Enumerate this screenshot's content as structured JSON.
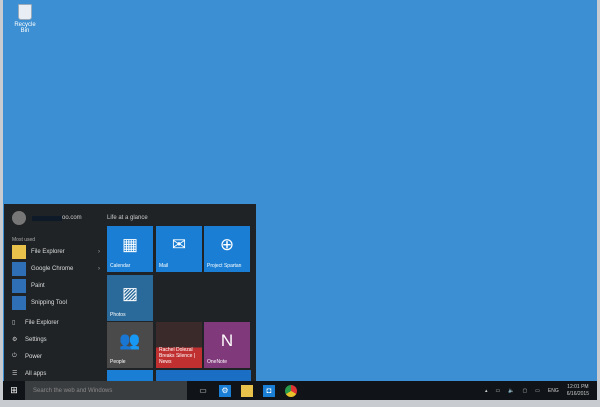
{
  "desktop": {
    "recycle_bin": "Recycle Bin"
  },
  "start": {
    "user_email": "oo.com",
    "most_used_label": "Most used",
    "apps": [
      {
        "label": "File Explorer",
        "color": "#e8c24a",
        "chev": true
      },
      {
        "label": "Google Chrome",
        "color": "#2f6fb5",
        "chev": true
      },
      {
        "label": "Paint",
        "color": "#2f6fb5",
        "chev": false
      },
      {
        "label": "Snipping Tool",
        "color": "#2f6fb5",
        "chev": false
      }
    ],
    "system": [
      {
        "icon": "▯",
        "label": "File Explorer"
      },
      {
        "icon": "⚙",
        "label": "Settings"
      },
      {
        "icon": "⏻",
        "label": "Power"
      },
      {
        "icon": "☰",
        "label": "All apps"
      }
    ],
    "tiles_label": "Life at a glance",
    "tiles": [
      {
        "label": "Calendar",
        "glyph": "▦",
        "color": "#1a7fd4"
      },
      {
        "label": "Mail",
        "glyph": "✉",
        "color": "#1a7fd4"
      },
      {
        "label": "Project Spartan",
        "glyph": "⊕",
        "color": "#1a7fd4"
      },
      {
        "label": "Photos",
        "glyph": "▨",
        "color": "#2a6a9a"
      },
      {
        "label": "People",
        "glyph": "👥",
        "color": "#4a4a4a"
      },
      {
        "label": "Rachel Dolezal Breaks Silence | News",
        "glyph": "",
        "color": "#c03030"
      },
      {
        "label": "OneNote",
        "glyph": "N",
        "color": "#80397b"
      }
    ]
  },
  "taskbar": {
    "search_placeholder": "Search the web and Windows",
    "time": "12:01 PM",
    "date": "6/16/2015",
    "lang": "ENG"
  }
}
